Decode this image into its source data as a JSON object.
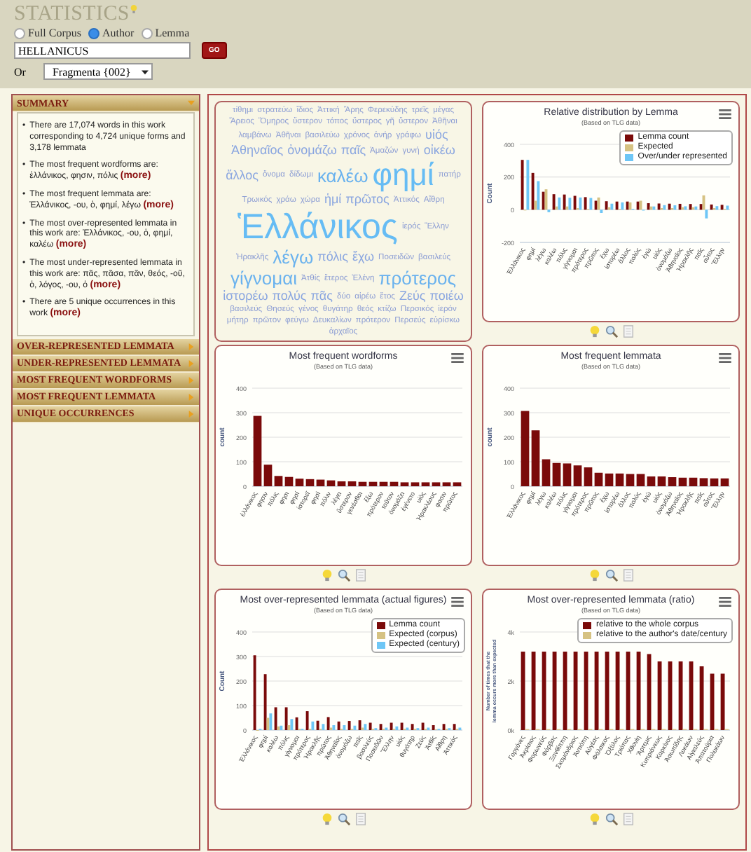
{
  "header": {
    "title": "STATISTICS",
    "scope_options": [
      {
        "label": "Full Corpus",
        "selected": false
      },
      {
        "label": "Author",
        "selected": true
      },
      {
        "label": "Lemma",
        "selected": false
      }
    ],
    "search": {
      "value": "HELLANICUS"
    },
    "go_button": "GO",
    "or_label": "Or",
    "work_select": "Fragmenta {002}"
  },
  "sidebar": {
    "sections": [
      {
        "title": "SUMMARY",
        "expanded": true,
        "items": [
          {
            "marker": "•",
            "text": "There are 17,074 words in this work corresponding to 4,724 unique forms and 3,178 lemmata"
          },
          {
            "marker": "•",
            "text": "The most frequent wordforms are: ἑλλάνικος, φησιν, πόλις",
            "link": "(more)"
          },
          {
            "marker": "•",
            "text": "The most frequent lemmata are: Ἑλλάνικος, -ου, ὁ, φημί, λέγω",
            "link": "(more)"
          },
          {
            "marker": "•",
            "text": "The most over-represented lemmata in this work are: Ἑλλάνικος, -ου, ὁ, φημί, καλέω",
            "link": "(more)"
          },
          {
            "marker": "•",
            "text": "The most under-represented lemmata in this work are: πᾶς, πᾶσα, πᾶν, θεός, -οῦ, ὁ, λόγος, -ου, ὁ",
            "link": "(more)"
          },
          {
            "marker": "•",
            "text": "There are 5 unique occurrences in this work",
            "link": "(more)"
          }
        ]
      },
      {
        "title": "OVER-REPRESENTED LEMMATA",
        "expanded": false
      },
      {
        "title": "UNDER-REPRESENTED LEMMATA",
        "expanded": false
      },
      {
        "title": "MOST FREQUENT WORDFORMS",
        "expanded": false
      },
      {
        "title": "MOST FREQUENT LEMMATA",
        "expanded": false
      },
      {
        "title": "UNIQUE OCCURRENCES",
        "expanded": false
      }
    ]
  },
  "word_cloud": {
    "words": [
      {
        "text": "τίθημι",
        "kind": "s"
      },
      {
        "text": "στρατεύω",
        "kind": "s"
      },
      {
        "text": "ἴδιος",
        "kind": "s"
      },
      {
        "text": "Ἀττική",
        "kind": "s"
      },
      {
        "text": "Ἄρης",
        "kind": "s"
      },
      {
        "text": "Φερεκύδης",
        "kind": "s"
      },
      {
        "text": "τρεῖς",
        "kind": "s"
      },
      {
        "text": "μέγας",
        "kind": "s"
      },
      {
        "text": "Ἄρειος",
        "kind": "s"
      },
      {
        "text": "Ὅμηρος",
        "kind": "s"
      },
      {
        "text": "ὕστερον",
        "kind": "s"
      },
      {
        "text": "τόπος",
        "kind": "s"
      },
      {
        "text": "ὕστερος",
        "kind": "s"
      },
      {
        "text": "γῆ",
        "kind": "s"
      },
      {
        "text": "ὕστερον",
        "kind": "s"
      },
      {
        "text": "Ἀθῆναι",
        "kind": "s"
      },
      {
        "text": "λαμβάνω",
        "kind": "s"
      },
      {
        "text": "Ἀθῆναι",
        "kind": "s"
      },
      {
        "text": "βασιλεύω",
        "kind": "s"
      },
      {
        "text": "χρόνος",
        "kind": "s"
      },
      {
        "text": "ἀνήρ",
        "kind": "s"
      },
      {
        "text": "γράφω",
        "kind": "s"
      },
      {
        "text": "υἱός",
        "kind": "m"
      },
      {
        "text": "Ἀθηναῖος",
        "kind": "m"
      },
      {
        "text": "ὀνομάζω",
        "kind": "m"
      },
      {
        "text": "παῖς",
        "kind": "m"
      },
      {
        "text": "Ἀμαζών",
        "kind": "s"
      },
      {
        "text": "γυνή",
        "kind": "s"
      },
      {
        "text": "οἰκέω",
        "kind": "m"
      },
      {
        "text": "ἄλλος",
        "kind": "m"
      },
      {
        "text": "ὄνομα",
        "kind": "s"
      },
      {
        "text": "δίδωμι",
        "kind": "s"
      },
      {
        "text": "καλέω",
        "kind": "l"
      },
      {
        "text": "φημί",
        "kind": "xl"
      },
      {
        "text": "πατήρ",
        "kind": "s"
      },
      {
        "text": "Τρωικός",
        "kind": "s"
      },
      {
        "text": "χράω",
        "kind": "s"
      },
      {
        "text": "χώρα",
        "kind": "s"
      },
      {
        "text": "ἡμί",
        "kind": "m"
      },
      {
        "text": "πρῶτος",
        "kind": "m"
      },
      {
        "text": "Ἀττικός",
        "kind": "s"
      },
      {
        "text": "Αἴθρη",
        "kind": "s"
      },
      {
        "text": "Ἑλλάνικος",
        "kind": "xxl"
      },
      {
        "text": "ἱερός",
        "kind": "s"
      },
      {
        "text": "Ἕλλην",
        "kind": "s"
      },
      {
        "text": "Ἡρακλῆς",
        "kind": "s"
      },
      {
        "text": "λέγω",
        "kind": "l"
      },
      {
        "text": "πόλις",
        "kind": "m"
      },
      {
        "text": "ἔχω",
        "kind": "m"
      },
      {
        "text": "Ποσειδῶν",
        "kind": "s"
      },
      {
        "text": "βασιλεύς",
        "kind": "s"
      },
      {
        "text": "γίγνομαι",
        "kind": "l"
      },
      {
        "text": "Ἀτθίς",
        "kind": "s"
      },
      {
        "text": "ἕτερος",
        "kind": "s"
      },
      {
        "text": "Ἑλένη",
        "kind": "s"
      },
      {
        "text": "πρότερος",
        "kind": "l"
      },
      {
        "text": "ἱστορέω",
        "kind": "m"
      },
      {
        "text": "πολύς",
        "kind": "m"
      },
      {
        "text": "πᾶς",
        "kind": "m"
      },
      {
        "text": "δύο",
        "kind": "s"
      },
      {
        "text": "αἱρέω",
        "kind": "s"
      },
      {
        "text": "ἔτος",
        "kind": "s"
      },
      {
        "text": "Ζεύς",
        "kind": "m"
      },
      {
        "text": "ποιέω",
        "kind": "m"
      },
      {
        "text": "βασιλεύς",
        "kind": "s"
      },
      {
        "text": "Θησεύς",
        "kind": "s"
      },
      {
        "text": "γένος",
        "kind": "s"
      },
      {
        "text": "θυγάτηρ",
        "kind": "s"
      },
      {
        "text": "θεός",
        "kind": "s"
      },
      {
        "text": "κτίζω",
        "kind": "s"
      },
      {
        "text": "Περσικός",
        "kind": "s"
      },
      {
        "text": "ἱερόν",
        "kind": "s"
      },
      {
        "text": "μήτηρ",
        "kind": "s"
      },
      {
        "text": "πρῶτον",
        "kind": "s"
      },
      {
        "text": "φεύγω",
        "kind": "s"
      },
      {
        "text": "Δευκαλίων",
        "kind": "s"
      },
      {
        "text": "πρότερον",
        "kind": "s"
      },
      {
        "text": "Περσεύς",
        "kind": "s"
      },
      {
        "text": "εὑρίσκω",
        "kind": "s"
      },
      {
        "text": "ἀρχαῖος",
        "kind": "s"
      }
    ]
  },
  "charts": [
    {
      "subtitle": "(Based on TLG data)",
      "chart_data": {
        "type": "bar",
        "title": "Relative distribution by Lemma",
        "grid": true,
        "legend": true,
        "ylabel": "Count",
        "ylim": [
          -200,
          400
        ],
        "yticks": [
          -200,
          0,
          200,
          400
        ],
        "categories": [
          "Ἑλλάνικος",
          "φημί",
          "λέγω",
          "καλέω",
          "πόλις",
          "γίγνομαι",
          "πρότερος",
          "πρῶτος",
          "ἔχω",
          "ἱστορέω",
          "ἄλλος",
          "πολύς",
          "ἐγώ",
          "υἱός",
          "ὀνομάζω",
          "Ἀθηναῖος",
          "Ἡρακλῆς",
          "παῖς",
          "οὗτος",
          "Ἕλλην"
        ],
        "series": [
          {
            "name": "Lemma count",
            "color": "#7a0a0a",
            "values": [
              305,
              225,
              110,
              95,
              93,
              85,
              77,
              55,
              52,
              50,
              50,
              50,
              40,
              38,
              37,
              36,
              35,
              35,
              32,
              30
            ]
          },
          {
            "name": "Expected",
            "color": "#d6c283",
            "values": [
              0,
              55,
              125,
              20,
              20,
              10,
              5,
              75,
              15,
              5,
              45,
              55,
              20,
              10,
              10,
              15,
              15,
              88,
              10,
              5
            ]
          },
          {
            "name": "Over/under represented",
            "color": "#6ec6f6",
            "values": [
              305,
              175,
              -15,
              75,
              73,
              75,
              72,
              -20,
              37,
              45,
              5,
              -5,
              20,
              28,
              27,
              21,
              20,
              -53,
              22,
              25
            ]
          }
        ]
      }
    },
    {
      "subtitle": "(Based on TLG data)",
      "chart_data": {
        "type": "bar",
        "title": "Most frequent wordforms",
        "grid": true,
        "ylabel": "count",
        "ylim": [
          0,
          400
        ],
        "yticks": [
          0,
          100,
          200,
          300,
          400
        ],
        "categories": [
          "ἑλλάνικος",
          "φησιν",
          "πόλις",
          "φησι",
          "φησί",
          "ἱστορεῖ",
          "φησὶ",
          "πόλιν",
          "λέγει",
          "ὕστερον",
          "γενέσθαι",
          "ἔξω",
          "πρότερον",
          "τοῦτον",
          "ὀνομάζει",
          "ἐγένετο",
          "υἱὸς",
          "Ἡρακλέους",
          "φασιν",
          "πρῶτος"
        ],
        "series": [
          {
            "color": "#7a0a0a",
            "values": [
              287,
              88,
              42,
              38,
              31,
              29,
              27,
              24,
              20,
              20,
              18,
              18,
              18,
              18,
              16,
              16,
              16,
              16,
              16,
              16
            ]
          }
        ]
      }
    },
    {
      "subtitle": "(Based on TLG data)",
      "chart_data": {
        "type": "bar",
        "title": "Most frequent lemmata",
        "grid": true,
        "ylabel": "count",
        "ylim": [
          0,
          400
        ],
        "yticks": [
          0,
          100,
          200,
          300,
          400
        ],
        "categories": [
          "Ἑλλάνικος",
          "φημί",
          "λέγω",
          "καλέω",
          "πόλις",
          "γίγνομαι",
          "πρότερος",
          "πρῶτος",
          "ἔχω",
          "ἱστορέω",
          "ἄλλος",
          "πολύς",
          "ἐγώ",
          "υἱός",
          "ὀνομάζω",
          "Ἀθηναῖος",
          "Ἡρακλῆς",
          "παῖς",
          "οὗτος",
          "Ἕλλην"
        ],
        "series": [
          {
            "color": "#7a0a0a",
            "values": [
              307,
              228,
              110,
              95,
              93,
              85,
              77,
              55,
              52,
              52,
              50,
              50,
              40,
              40,
              37,
              35,
              35,
              33,
              32,
              32
            ]
          }
        ]
      }
    },
    {
      "subtitle": "(Based on TLG data)",
      "chart_data": {
        "type": "bar",
        "title": "Most over-represented lemmata (actual figures)",
        "grid": true,
        "legend": true,
        "ylabel": "Count",
        "ylim": [
          0,
          400
        ],
        "yticks": [
          0,
          100,
          200,
          300,
          400
        ],
        "categories": [
          "Ἑλλάνικος",
          "φημί",
          "καλέω",
          "πόλις",
          "γίγνομαι",
          "πρότερος",
          "Ἡρακλῆς",
          "πρῶτος",
          "Ἀθηναῖος",
          "ὀνομάζω",
          "παῖς",
          "βασιλεύς",
          "Ποσειδῶν",
          "Ἕλλην",
          "υἱός",
          "θυγάτηρ",
          "Ζεύς",
          "Ἀτθίς",
          "Αἴθρη",
          "Ἀττικός"
        ],
        "series": [
          {
            "name": "Lemma count",
            "color": "#7a0a0a",
            "values": [
              305,
              228,
              93,
              93,
              52,
              77,
              38,
              53,
              35,
              37,
              40,
              30,
              25,
              30,
              30,
              25,
              30,
              20,
              25,
              25
            ]
          },
          {
            "name": "Expected (corpus)",
            "color": "#d6c283",
            "values": [
              0,
              50,
              15,
              20,
              5,
              5,
              5,
              10,
              5,
              5,
              10,
              5,
              5,
              5,
              5,
              5,
              5,
              3,
              5,
              5
            ]
          },
          {
            "name": "Expected (century)",
            "color": "#6ec6f6",
            "values": [
              5,
              68,
              18,
              45,
              5,
              35,
              25,
              20,
              20,
              18,
              25,
              8,
              10,
              15,
              10,
              8,
              10,
              5,
              8,
              10
            ]
          }
        ]
      }
    },
    {
      "subtitle": "(Based on TLG data)",
      "chart_data": {
        "type": "bar",
        "title": "Most over-represented lemmata (ratio)",
        "grid": true,
        "legend": true,
        "ylabel": "Number of times that the lemma occurs more than expected",
        "ylim": [
          0,
          4000
        ],
        "yticks": [
          {
            "value": 0,
            "label": "0k"
          },
          {
            "value": 2000,
            "label": "2k"
          },
          {
            "value": 4000,
            "label": "4k"
          }
        ],
        "categories": [
          "Γοργόνες",
          "Ἀκρίσιος",
          "Φορωνεύς",
          "Φόρβας",
          "Ξανθίππη",
          "Σκαμάνδριος",
          "Ἀντιόπη",
          "Αὐγέας",
          "Φάλαικος",
          "Ὀξύλος",
          "Τριόπας",
          "Χθονίη",
          "Ἄρτεμις",
          "Κυπριάνεως",
          "Καρκίνος",
          "Ἀσωπίδης",
          "Λυκάων",
          "Αἰγιαλεύς",
          "Ἀπατούρια",
          "Πολυκάων"
        ],
        "series": [
          {
            "name": "relative to the whole corpus",
            "color": "#7a0a0a",
            "values": [
              3200,
              3200,
              3200,
              3200,
              3200,
              3200,
              3200,
              3200,
              3200,
              3200,
              3200,
              3200,
              3100,
              2800,
              2800,
              2800,
              2800,
              2600,
              2300,
              2300
            ]
          },
          {
            "name": "relative to the author's date/century",
            "color": "#d6c283",
            "values": [
              40,
              40,
              40,
              40,
              40,
              40,
              40,
              40,
              40,
              40,
              40,
              40,
              40,
              40,
              40,
              40,
              40,
              40,
              40,
              40
            ]
          }
        ]
      }
    }
  ]
}
